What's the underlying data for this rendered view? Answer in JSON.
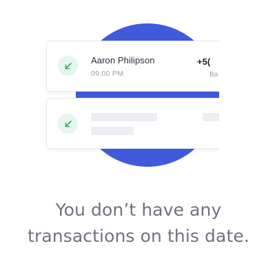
{
  "illustration": {
    "accent_color": "#3f5bdc",
    "badge_color": "#e5f6ec",
    "arrow_color": "#2fb16a",
    "card_1": {
      "icon": "arrow-down-left-icon",
      "name": "Aaron Philipson",
      "time": "09:00 PM",
      "amount_partial": "+5(",
      "subtext_partial": "Ba"
    },
    "card_2": {
      "icon": "arrow-down-left-icon",
      "placeholder": true
    }
  },
  "empty_state": {
    "line_1": "You don’t have any",
    "line_2": "transactions on this date."
  }
}
